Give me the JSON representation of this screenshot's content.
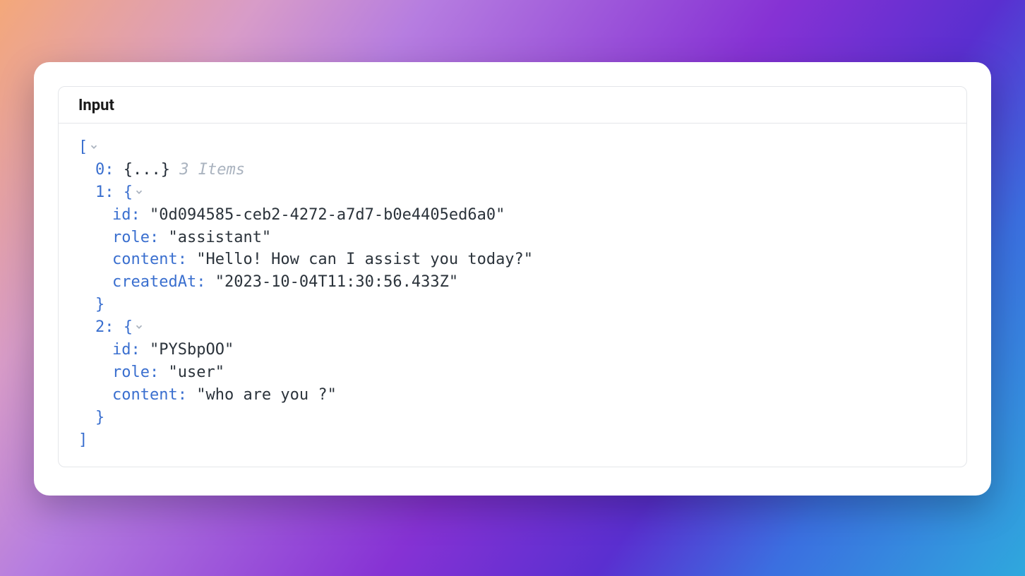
{
  "panel": {
    "title": "Input"
  },
  "json": {
    "open_bracket": "[",
    "close_bracket": "]",
    "items": {
      "item0_index": "0",
      "item0_collapsed": "{...}",
      "item0_meta": "3 Items",
      "item1": {
        "index": "1",
        "id_key": "id",
        "id_value": "\"0d094585-ceb2-4272-a7d7-b0e4405ed6a0\"",
        "role_key": "role",
        "role_value": "\"assistant\"",
        "content_key": "content",
        "content_value": "\"Hello! How can I assist you today?\"",
        "createdAt_key": "createdAt",
        "createdAt_value": "\"2023-10-04T11:30:56.433Z\""
      },
      "item2": {
        "index": "2",
        "id_key": "id",
        "id_value": "\"PYSbpOO\"",
        "role_key": "role",
        "role_value": "\"user\"",
        "content_key": "content",
        "content_value": "\"who are you ?\""
      }
    },
    "open_brace": "{",
    "close_brace": "}",
    "colon": ":"
  }
}
